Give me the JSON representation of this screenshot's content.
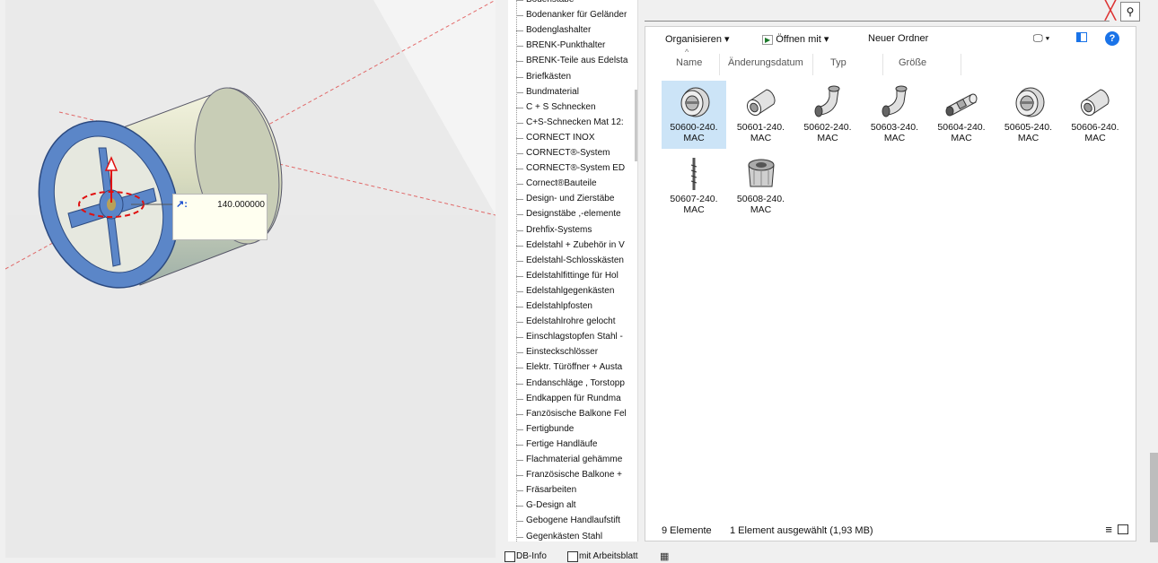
{
  "viewport": {
    "dimension_value": "140.000000"
  },
  "tree": {
    "items": [
      "Bodenstäbe",
      "Bodenanker für Geländer",
      "Bodenglashalter",
      "BRENK-Punkthalter",
      "BRENK-Teile aus Edelsta",
      "Briefkästen",
      "Bundmaterial",
      "C + S Schnecken",
      "C+S-Schnecken Mat 12:",
      "CORNECT INOX",
      "CORNECT®-System",
      "CORNECT®-System ED",
      "Cornect®Bauteile",
      "Design- und Zierstäbe",
      "Designstäbe ,-elemente",
      "Drehfix-Systems",
      "Edelstahl + Zubehör in V",
      "Edelstahl-Schlosskästen",
      "Edelstahlfittinge für Hol",
      "Edelstahlgegenkästen",
      "Edelstahlpfosten",
      "Edelstahlrohre gelocht",
      "Einschlagstopfen Stahl -",
      "Einsteckschlösser",
      "Elektr. Türöffner + Austa",
      "Endanschläge , Torstopp",
      "Endkappen für Rundma",
      "Fanzösische Balkone Fel",
      "Fertigbunde",
      "Fertige Handläufe",
      "Flachmaterial gehämme",
      "Französische Balkone +",
      "Fräsarbeiten",
      "G-Design alt",
      "Gebogene Handlaufstift",
      "Gegenkästen Stahl"
    ]
  },
  "bottombar": {
    "db_info": "DB-Info",
    "mit_arbeitsblatt": "mit Arbeitsblatt"
  },
  "toolbar": {
    "organize": "Organisieren ▾",
    "open_with": "Öffnen mit ▾",
    "new_folder": "Neuer Ordner",
    "help": "?"
  },
  "columns": {
    "name": "Name",
    "date": "Änderungsdatum",
    "type": "Typ",
    "size": "Größe"
  },
  "files": [
    {
      "line1": "50600-240.",
      "line2": "MAC",
      "icon": "ring-part-icon"
    },
    {
      "line1": "50601-240.",
      "line2": "MAC",
      "icon": "sleeve-part-icon"
    },
    {
      "line1": "50602-240.",
      "line2": "MAC",
      "icon": "elbow-part-icon"
    },
    {
      "line1": "50603-240.",
      "line2": "MAC",
      "icon": "elbow-part-icon"
    },
    {
      "line1": "50604-240.",
      "line2": "MAC",
      "icon": "connector-part-icon"
    },
    {
      "line1": "50605-240.",
      "line2": "MAC",
      "icon": "ring-part-icon"
    },
    {
      "line1": "50606-240.",
      "line2": "MAC",
      "icon": "sleeve-part-icon"
    },
    {
      "line1": "50607-240.",
      "line2": "MAC",
      "icon": "screw-part-icon"
    },
    {
      "line1": "50608-240.",
      "line2": "MAC",
      "icon": "cap-part-icon"
    }
  ],
  "status": {
    "count": "9 Elemente",
    "selection": "1 Element ausgewählt (1,93 MB)"
  },
  "colors": {
    "accent": "#1a73e8",
    "selection": "#cce4f7",
    "part_blue": "#5b86c8"
  }
}
